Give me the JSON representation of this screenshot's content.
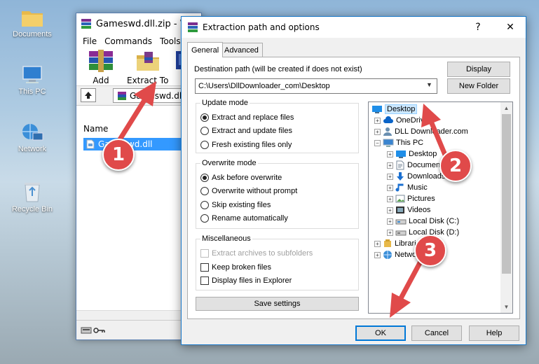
{
  "desktop": {
    "icons": [
      {
        "label": "Documents",
        "icon": "folder-icon"
      },
      {
        "label": "This PC",
        "icon": "computer-icon"
      },
      {
        "label": "Network",
        "icon": "network-icon"
      },
      {
        "label": "Recycle Bin",
        "icon": "recycle-bin-icon"
      }
    ]
  },
  "winrar": {
    "title": "Gameswd.dll.zip - W",
    "menu": [
      "File",
      "Commands",
      "Tools"
    ],
    "toolbar": {
      "add": "Add",
      "extract_to": "Extract To"
    },
    "address": "Gameswd.dll",
    "column_name": "Name",
    "file": "Gameswd.dll"
  },
  "dialog": {
    "title": "Extraction path and options",
    "help_btn": "?",
    "close_btn": "✕",
    "tabs": [
      "General",
      "Advanced"
    ],
    "dest_label": "Destination path (will be created if does not exist)",
    "dest_value": "C:\\Users\\DllDownloader_com\\Desktop",
    "display_btn": "Display",
    "new_folder_btn": "New Folder",
    "update_mode": {
      "title": "Update mode",
      "options": [
        "Extract and replace files",
        "Extract and update files",
        "Fresh existing files only"
      ],
      "selected": 0
    },
    "overwrite_mode": {
      "title": "Overwrite mode",
      "options": [
        "Ask before overwrite",
        "Overwrite without prompt",
        "Skip existing files",
        "Rename automatically"
      ],
      "selected": 0
    },
    "misc": {
      "title": "Miscellaneous",
      "options": [
        "Extract archives to subfolders",
        "Keep broken files",
        "Display files in Explorer"
      ]
    },
    "save_settings": "Save settings",
    "tree": [
      {
        "label": "Desktop",
        "selected": true
      },
      {
        "label": "OneDrive"
      },
      {
        "label": "DLL Downloader.com"
      },
      {
        "label": "This PC"
      },
      {
        "label": "Desktop"
      },
      {
        "label": "Documents"
      },
      {
        "label": "Downloads"
      },
      {
        "label": "Music"
      },
      {
        "label": "Pictures"
      },
      {
        "label": "Videos"
      },
      {
        "label": "Local Disk (C:)"
      },
      {
        "label": "Local Disk (D:)"
      },
      {
        "label": "Libraries"
      },
      {
        "label": "Network"
      }
    ],
    "ok": "OK",
    "cancel": "Cancel",
    "help": "Help"
  },
  "annotations": {
    "colors": {
      "arrow": "#e04a4a"
    },
    "steps": [
      "1",
      "2",
      "3"
    ]
  }
}
